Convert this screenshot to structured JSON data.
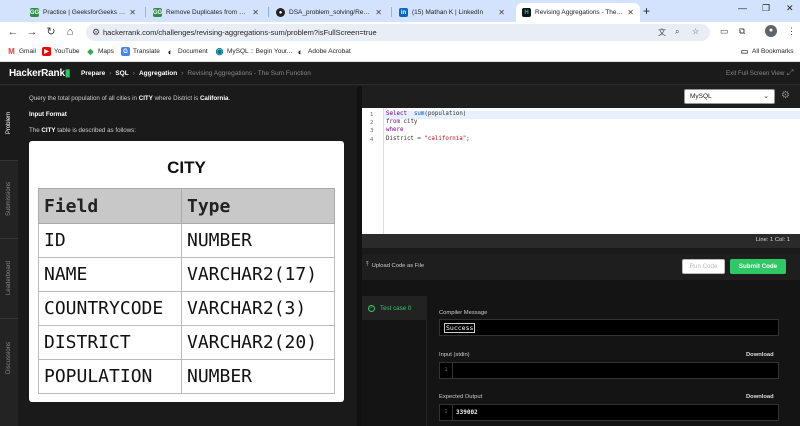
{
  "browser": {
    "tabs": [
      {
        "title": "Practice | GeeksforGeeks | A co",
        "favicon": "GG",
        "color": "#2f8d46",
        "active": false
      },
      {
        "title": "Remove Duplicates from a Sor",
        "favicon": "GG",
        "color": "#2f8d46",
        "active": false
      },
      {
        "title": "DSA_problem_solving/Remove",
        "favicon": "github-icon",
        "color": "#222222",
        "active": false
      },
      {
        "title": "(15) Mathan K | LinkedIn",
        "favicon": "in",
        "color": "#0a66c2",
        "active": false
      },
      {
        "title": "Revising Aggregations - The Su",
        "favicon": "H",
        "color": "#0e141e",
        "active": true
      }
    ],
    "url": "hackerrank.com/challenges/revising-aggregations-sum/problem?isFullScreen=true",
    "bookmarks": [
      {
        "label": "Gmail",
        "icon": "M",
        "color": "#ea4335"
      },
      {
        "label": "YouTube",
        "icon": "▶",
        "color": "#ff0000"
      },
      {
        "label": "Maps",
        "icon": "◆",
        "color": "#34a853"
      },
      {
        "label": "Translate",
        "icon": "G",
        "color": "#4285f4"
      },
      {
        "label": "Document",
        "icon": "◐",
        "color": "#202124"
      },
      {
        "label": "MySQL :: Begin Your...",
        "icon": "◉",
        "color": "#00758f"
      },
      {
        "label": "Adobe Acrobat",
        "icon": "◐",
        "color": "#202124"
      }
    ],
    "all_bookmarks": "All Bookmarks"
  },
  "hr": {
    "logo_text": "HackerRank",
    "breadcrumbs": [
      "Prepare",
      "SQL",
      "Aggregation",
      "Revising Aggregations - The Sum Function"
    ],
    "exit_fullscreen": "Exit Full Screen View",
    "side_tabs": [
      "Problem",
      "Submissions",
      "Leaderboard",
      "Discussions"
    ]
  },
  "problem": {
    "q_pre": "Query the total population of all cities in ",
    "q_b1": "CITY",
    "q_mid": " where District is ",
    "q_b2": "California",
    "q_end": ".",
    "input_format": "Input Format",
    "desc_pre": "The ",
    "desc_b": "CITY",
    "desc_end": " table is described as follows:",
    "table_title": "CITY",
    "columns": [
      "Field",
      "Type"
    ],
    "rows": [
      [
        "ID",
        "NUMBER"
      ],
      [
        "NAME",
        "VARCHAR2(17)"
      ],
      [
        "COUNTRYCODE",
        "VARCHAR2(3)"
      ],
      [
        "DISTRICT",
        "VARCHAR2(20)"
      ],
      [
        "POPULATION",
        "NUMBER"
      ]
    ]
  },
  "editor": {
    "language": "MySQL",
    "line_numbers": [
      "1",
      "2",
      "3",
      "4"
    ],
    "status": "Line: 1 Col: 1",
    "upload_label": "Upload Code as File",
    "run_label": "Run Code",
    "submit_label": "Submit Code"
  },
  "results": {
    "test_case": "Test case 0",
    "compiler_label": "Compiler Message",
    "compiler_value": "Success",
    "input_label": "Input (stdin)",
    "input_line": "1",
    "expected_label": "Expected Output",
    "expected_line": "1",
    "expected_value": "339002",
    "download_label": "Download"
  },
  "colors": {
    "accent": "#2ec866",
    "header": "#1b1b1b",
    "tabstrip": "#d3e3fd"
  }
}
